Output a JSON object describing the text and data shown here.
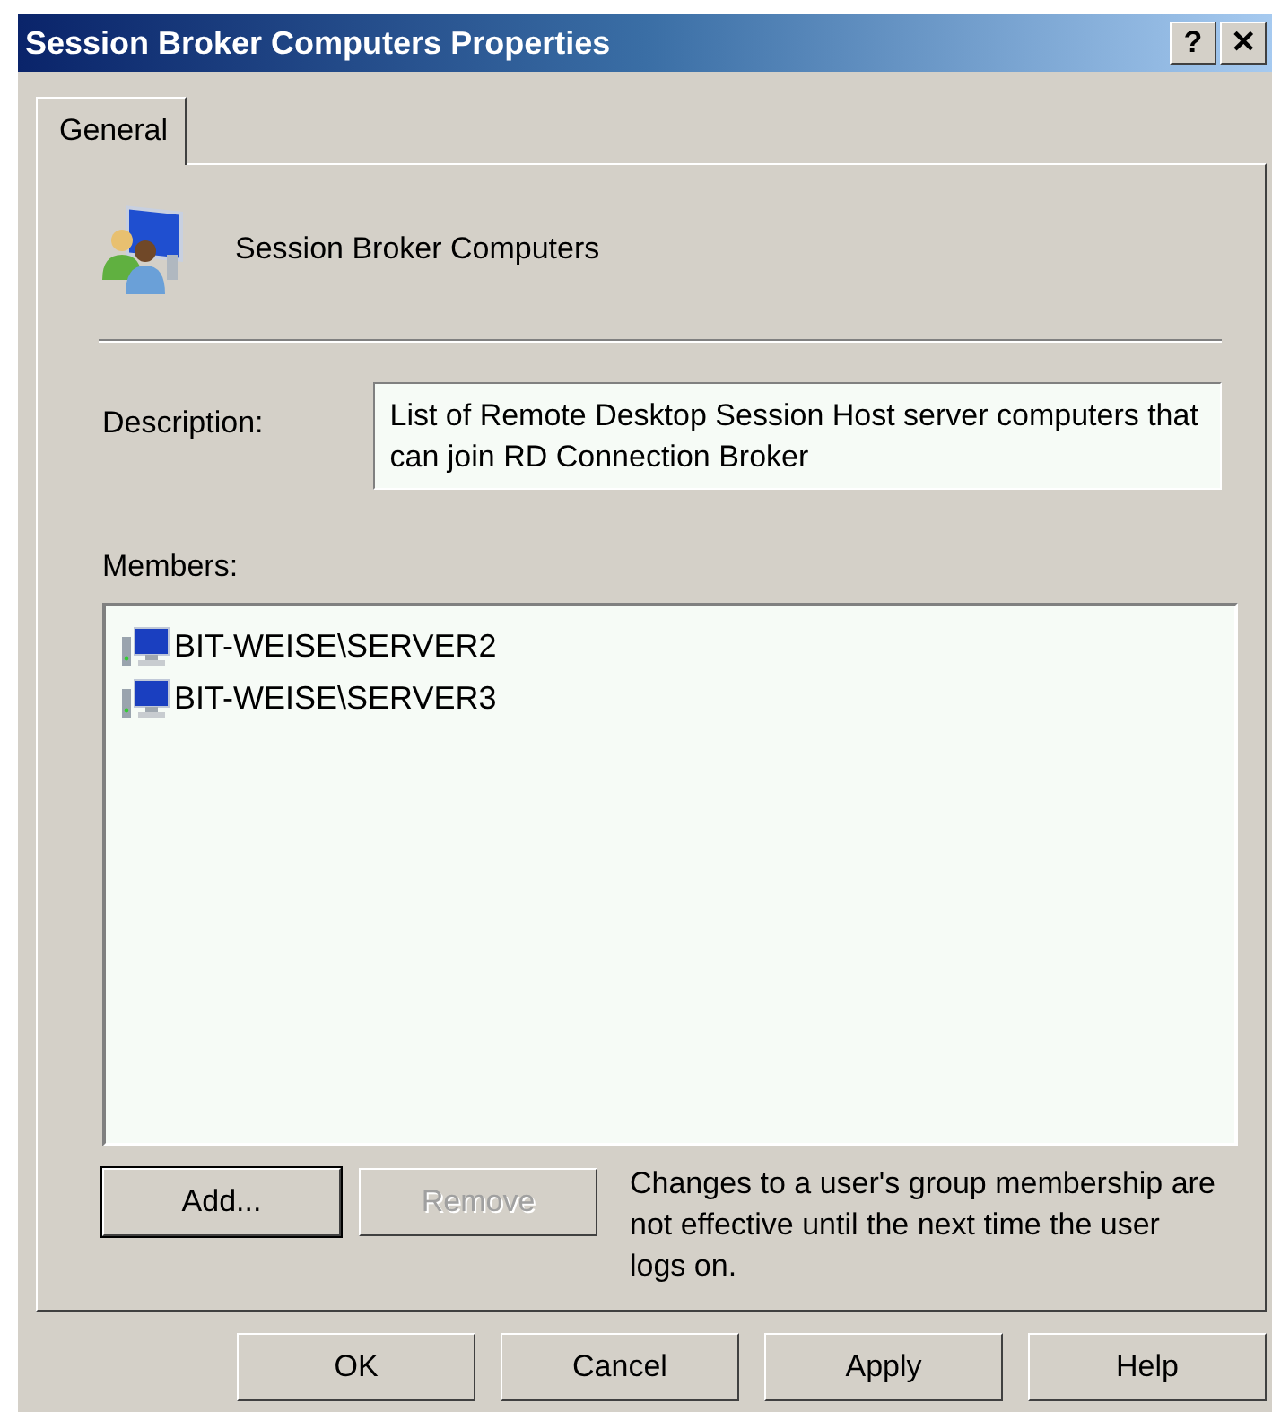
{
  "window": {
    "title": "Session Broker Computers Properties",
    "help_button": "?",
    "close_button": "✕"
  },
  "tabs": [
    {
      "label": "General",
      "selected": true
    }
  ],
  "group": {
    "name": "Session Broker Computers"
  },
  "description": {
    "label": "Description:",
    "value": "List of Remote Desktop Session Host server computers that can join RD Connection Broker"
  },
  "members": {
    "label": "Members:",
    "items": [
      {
        "name": "BIT-WEISE\\SERVER2"
      },
      {
        "name": "BIT-WEISE\\SERVER3"
      }
    ]
  },
  "member_buttons": [
    {
      "label": "Add...",
      "disabled": false,
      "default": true
    },
    {
      "label": "Remove",
      "disabled": true,
      "default": false
    }
  ],
  "note": "Changes to a user's group membership are not effective until the next time the user logs on.",
  "buttons": [
    {
      "label": "OK"
    },
    {
      "label": "Cancel"
    },
    {
      "label": "Apply"
    },
    {
      "label": "Help"
    }
  ]
}
